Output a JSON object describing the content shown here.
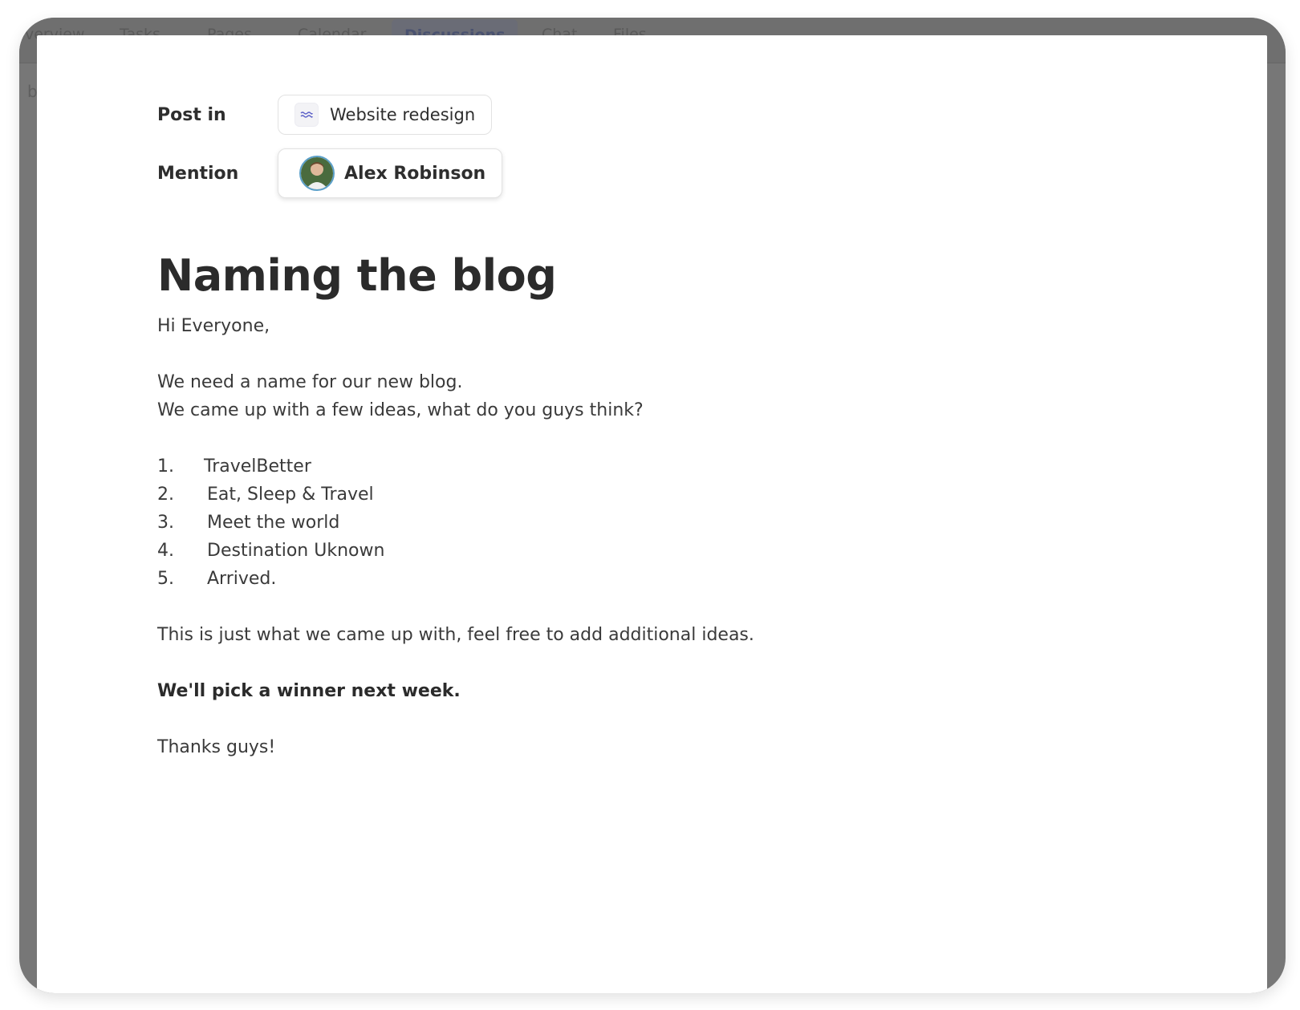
{
  "background_tabs": [
    "Overview",
    "Tasks",
    "Pages",
    "Calendar",
    "Discussions",
    "Chat",
    "Files"
  ],
  "background_side_letter": "b",
  "post_in": {
    "label": "Post in",
    "project": "Website redesign",
    "icon": "project-waves-icon"
  },
  "mention": {
    "label": "Mention",
    "person": "Alex Robinson",
    "icon": "avatar"
  },
  "discussion": {
    "title": "Naming the blog",
    "greeting": "Hi Everyone,",
    "line1": "We need a name for our new blog.",
    "line2": "We came up with a few ideas, what do you guys think?",
    "ideas": [
      {
        "num": "1.",
        "text": "TravelBetter"
      },
      {
        "num": "2.",
        "text": "Eat, Sleep & Travel"
      },
      {
        "num": "3.",
        "text": "Meet the world"
      },
      {
        "num": "4.",
        "text": "Destination Uknown"
      },
      {
        "num": "5.",
        "text": "Arrived."
      }
    ],
    "closing": "This is just what we came up with, feel free to add additional ideas.",
    "bold_line": "We'll pick a winner next week.",
    "signoff": "Thanks guys!"
  },
  "colors": {
    "overlay": "#777777",
    "modal_bg": "#ffffff",
    "text": "#2e2e2e",
    "accent": "#4a5270"
  }
}
